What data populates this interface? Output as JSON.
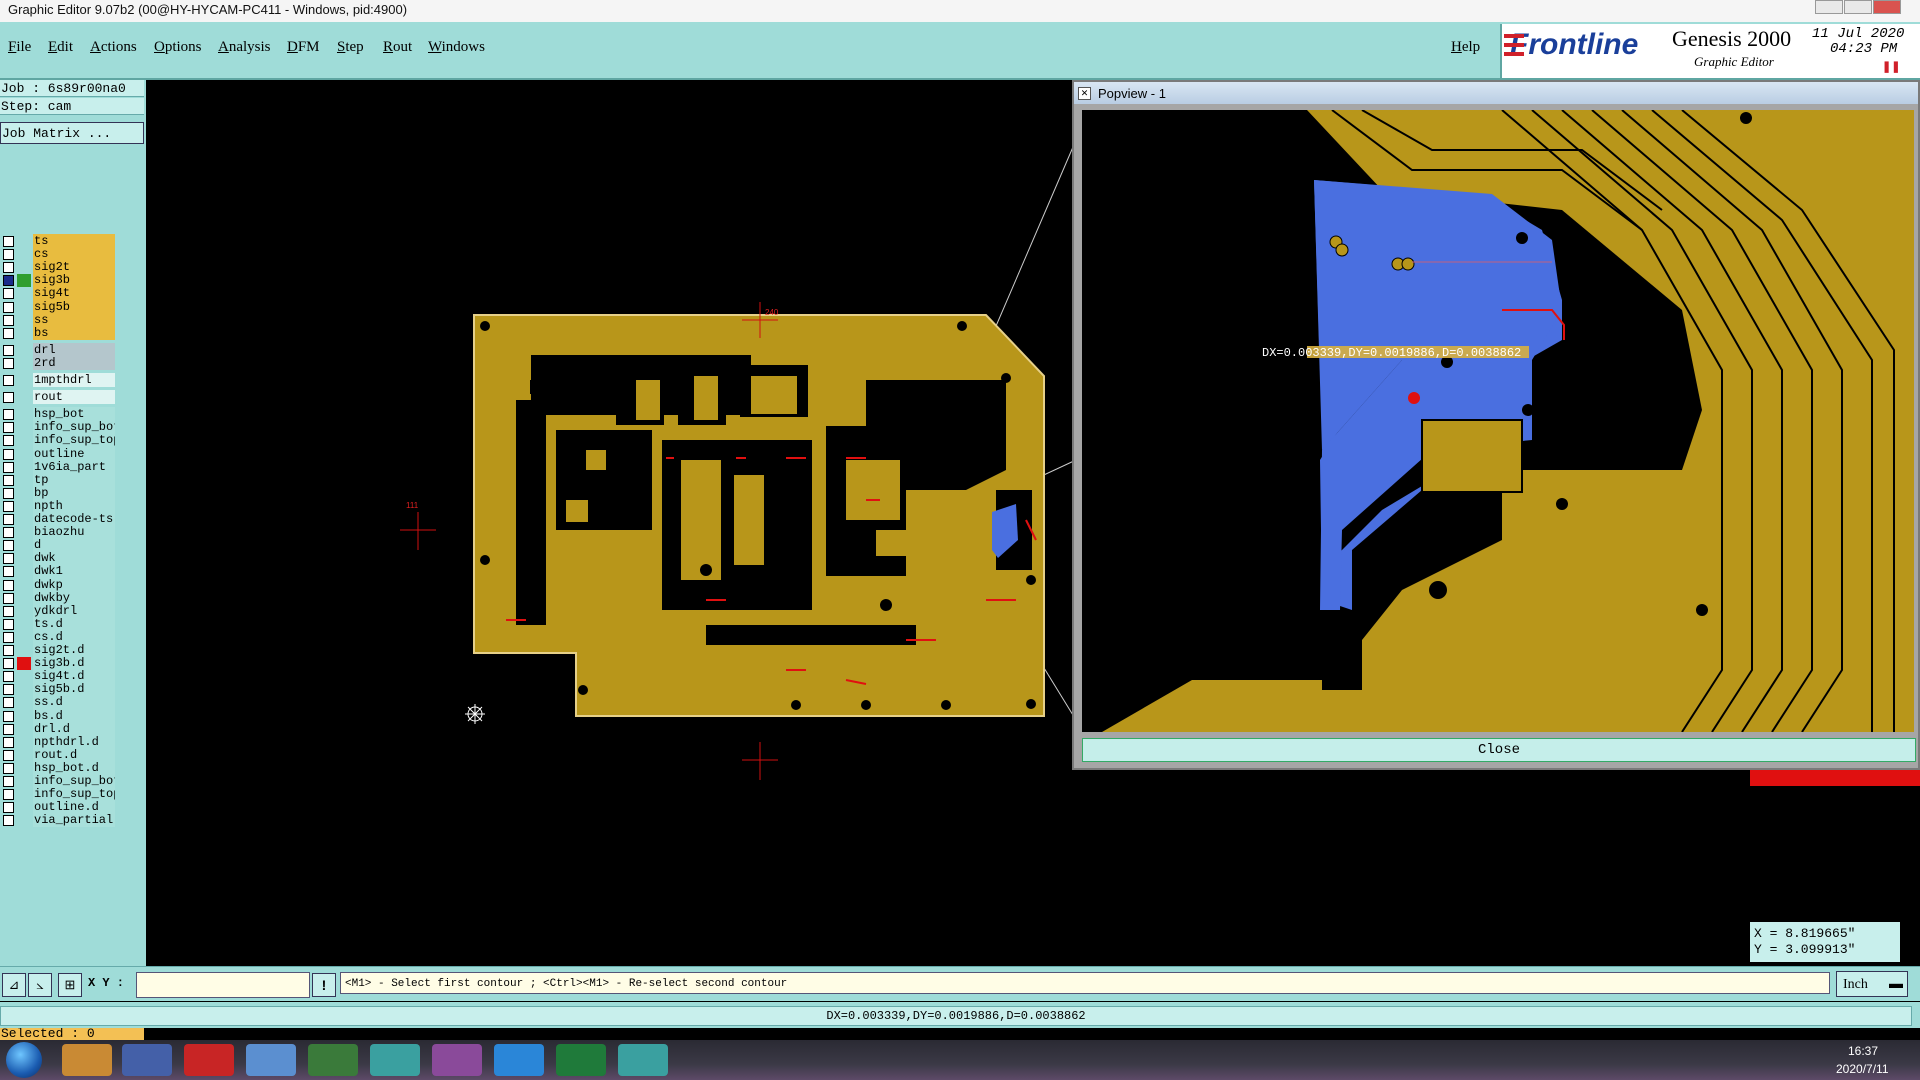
{
  "window": {
    "title": "Graphic Editor 9.07b2 (00@HY-HYCAM-PC411 - Windows, pid:4900)"
  },
  "menu": {
    "items": [
      "File",
      "Edit",
      "Actions",
      "Options",
      "Analysis",
      "DFM",
      "Step",
      "Rout",
      "Windows"
    ],
    "help": "Help"
  },
  "brand": {
    "logo": "Frontline",
    "product": "Genesis 2000",
    "subtitle": "Graphic Editor",
    "date": "11 Jul 2020",
    "time": "04:23 PM"
  },
  "job": {
    "job_label": "Job : 6s89r00na0",
    "step_label": "Step: cam",
    "matrix_button": "Job Matrix ..."
  },
  "layers": [
    {
      "name": "ts",
      "kind": "board",
      "sw": ""
    },
    {
      "name": "cs",
      "kind": "board",
      "sw": ""
    },
    {
      "name": "sig2t",
      "kind": "board",
      "sw": ""
    },
    {
      "name": "sig3b",
      "kind": "board",
      "sw": "#2f9e2f",
      "active": true
    },
    {
      "name": "sig4t",
      "kind": "board",
      "sw": ""
    },
    {
      "name": "sig5b",
      "kind": "board",
      "sw": ""
    },
    {
      "name": "ss",
      "kind": "board",
      "sw": ""
    },
    {
      "name": "bs",
      "kind": "board",
      "sw": ""
    },
    {
      "name": "drl",
      "kind": "drill",
      "sw": "",
      "gap": true
    },
    {
      "name": "2rd",
      "kind": "drill",
      "sw": ""
    },
    {
      "name": "1mpthdrl",
      "kind": "rout",
      "sw": "",
      "gap": true
    },
    {
      "name": "rout",
      "kind": "rout",
      "sw": "",
      "gap": true
    },
    {
      "name": "hsp_bot",
      "kind": "misc",
      "sw": "",
      "gap": true
    },
    {
      "name": "info_sup_bot",
      "kind": "misc",
      "sw": ""
    },
    {
      "name": "info_sup_top",
      "kind": "misc",
      "sw": ""
    },
    {
      "name": "outline",
      "kind": "misc",
      "sw": ""
    },
    {
      "name": "1v6ia_part",
      "kind": "misc",
      "sw": ""
    },
    {
      "name": "tp",
      "kind": "misc",
      "sw": ""
    },
    {
      "name": "bp",
      "kind": "misc",
      "sw": ""
    },
    {
      "name": "npth",
      "kind": "misc",
      "sw": ""
    },
    {
      "name": "datecode-ts",
      "kind": "misc",
      "sw": ""
    },
    {
      "name": "biaozhu",
      "kind": "misc",
      "sw": ""
    },
    {
      "name": "d",
      "kind": "misc",
      "sw": ""
    },
    {
      "name": "dwk",
      "kind": "misc",
      "sw": ""
    },
    {
      "name": "dwk1",
      "kind": "misc",
      "sw": ""
    },
    {
      "name": "dwkp",
      "kind": "misc",
      "sw": ""
    },
    {
      "name": "dwkby",
      "kind": "misc",
      "sw": ""
    },
    {
      "name": "ydkdrl",
      "kind": "misc",
      "sw": ""
    },
    {
      "name": "ts.d",
      "kind": "misc",
      "sw": ""
    },
    {
      "name": "cs.d",
      "kind": "misc",
      "sw": ""
    },
    {
      "name": "sig2t.d",
      "kind": "misc",
      "sw": ""
    },
    {
      "name": "sig3b.d",
      "kind": "misc",
      "sw": "#e01010"
    },
    {
      "name": "sig4t.d",
      "kind": "misc",
      "sw": ""
    },
    {
      "name": "sig5b.d",
      "kind": "misc",
      "sw": ""
    },
    {
      "name": "ss.d",
      "kind": "misc",
      "sw": ""
    },
    {
      "name": "bs.d",
      "kind": "misc",
      "sw": ""
    },
    {
      "name": "drl.d",
      "kind": "misc",
      "sw": ""
    },
    {
      "name": "npthdrl.d",
      "kind": "misc",
      "sw": ""
    },
    {
      "name": "rout.d",
      "kind": "misc",
      "sw": ""
    },
    {
      "name": "hsp_bot.d",
      "kind": "misc",
      "sw": ""
    },
    {
      "name": "info_sup_bot",
      "kind": "misc",
      "sw": ""
    },
    {
      "name": "info_sup_top",
      "kind": "misc",
      "sw": ""
    },
    {
      "name": "outline.d",
      "kind": "misc",
      "sw": ""
    },
    {
      "name": "via_partial",
      "kind": "misc",
      "sw": ""
    }
  ],
  "selected": "Selected : 0",
  "canvas": {
    "marker_labels": [
      "240",
      "111"
    ]
  },
  "popview": {
    "title": "Popview - 1",
    "measure_label": "DX=0.003339,DY=0.0019886,D=0.0038862",
    "close": "Close"
  },
  "coords": {
    "x": "X = 8.819665\"",
    "y": "Y = 3.099913\""
  },
  "command": {
    "xy_label": "X Y :",
    "xy_value": "",
    "prompt": "<M1> - Select first contour ; <Ctrl><M1> - Re-select second contour",
    "units": "Inch"
  },
  "status": "DX=0.003339,DY=0.0019886,D=0.0038862",
  "taskbar": {
    "time": "16:37",
    "date": "2020/7/11"
  },
  "colors": {
    "copper": "#b8961a",
    "selection": "#4a6fe0",
    "menu_bg": "#9fdcd8",
    "board_layer": "#e8bc3f",
    "brand_red": "#d0202a",
    "brand_blue": "#1a3f9a"
  }
}
